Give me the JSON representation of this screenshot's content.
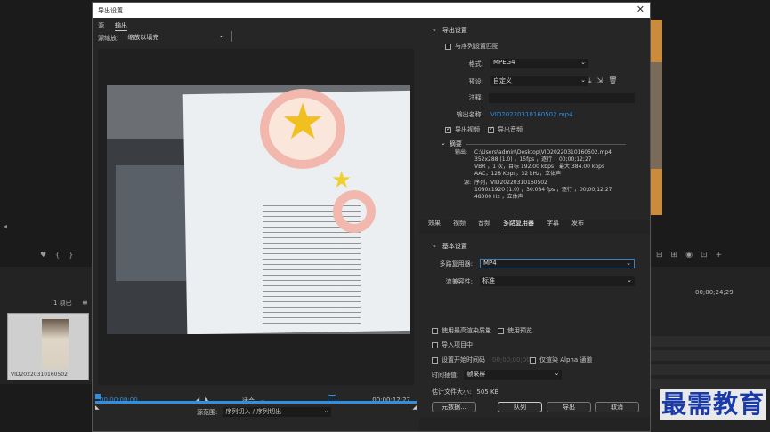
{
  "background_app": {
    "items_label": "1 项已",
    "clip_name": "VID20220310160502",
    "timecode_right": "00;00;24;29"
  },
  "dialog": {
    "title": "导出设置",
    "source_tabs": [
      "源",
      "输出"
    ],
    "scale_label": "源缩放:",
    "scale_value": "缩放以填充",
    "timecode_in": "00;00;00;00",
    "timecode_out": "00;00;12;27",
    "fit_value": "适合",
    "range_label": "源范围:",
    "range_value": "序列切入 / 序列切出",
    "export_settings": {
      "header": "导出设置",
      "match_sequence": "与序列设置匹配",
      "format_label": "格式:",
      "format_value": "MPEG4",
      "preset_label": "预设:",
      "preset_value": "自定义",
      "comment_label": "注释:",
      "output_name_label": "输出名称:",
      "output_name_value": "VID20220310160502.mp4",
      "export_video": "导出视频",
      "export_audio": "导出音频",
      "summary_header": "摘要",
      "output_key": "输出:",
      "output_lines": [
        "C:\\Users\\admin\\Desktop\\VID20220310160502.mp4",
        "352x288 (1.0) ，15fps ，逐行 ，00;00;12;27",
        "VBR ，1 次，目标 192.00 kbps，最大 384.00 kbps",
        "AAC，128 Kbps，32 kHz，立体声"
      ],
      "source_key": "源:",
      "source_lines": [
        "序列，VID20220310160502",
        "1080x1920 (1.0) ，30.084 fps ，逐行 ，00;00;12;27",
        "48000 Hz ，立体声"
      ]
    },
    "tabs": [
      "效果",
      "视频",
      "音频",
      "多路复用器",
      "字幕",
      "发布"
    ],
    "active_tab": "多路复用器",
    "basic": {
      "header": "基本设置",
      "mux_label": "多路复用器:",
      "mux_value": "MP4",
      "compat_label": "流兼容性:",
      "compat_value": "标准"
    },
    "bottom": {
      "max_render": "使用最高渲染质量",
      "use_preview": "使用预览",
      "import_project": "导入项目中",
      "set_start_tc": "设置开始时间码",
      "start_tc_value": "00;00;00;00",
      "alpha_only": "仅渲染 Alpha 通道",
      "interp_label": "时间插值:",
      "interp_value": "帧采样",
      "filesize_label": "估计文件大小:",
      "filesize_value": "505 KB",
      "btn_metadata": "元数据...",
      "btn_queue": "队列",
      "btn_export": "导出",
      "btn_cancel": "取消"
    }
  },
  "watermark": "最需教育",
  "colors": {
    "accent": "#2f8fe0",
    "watermark": "#1a3aa8"
  }
}
